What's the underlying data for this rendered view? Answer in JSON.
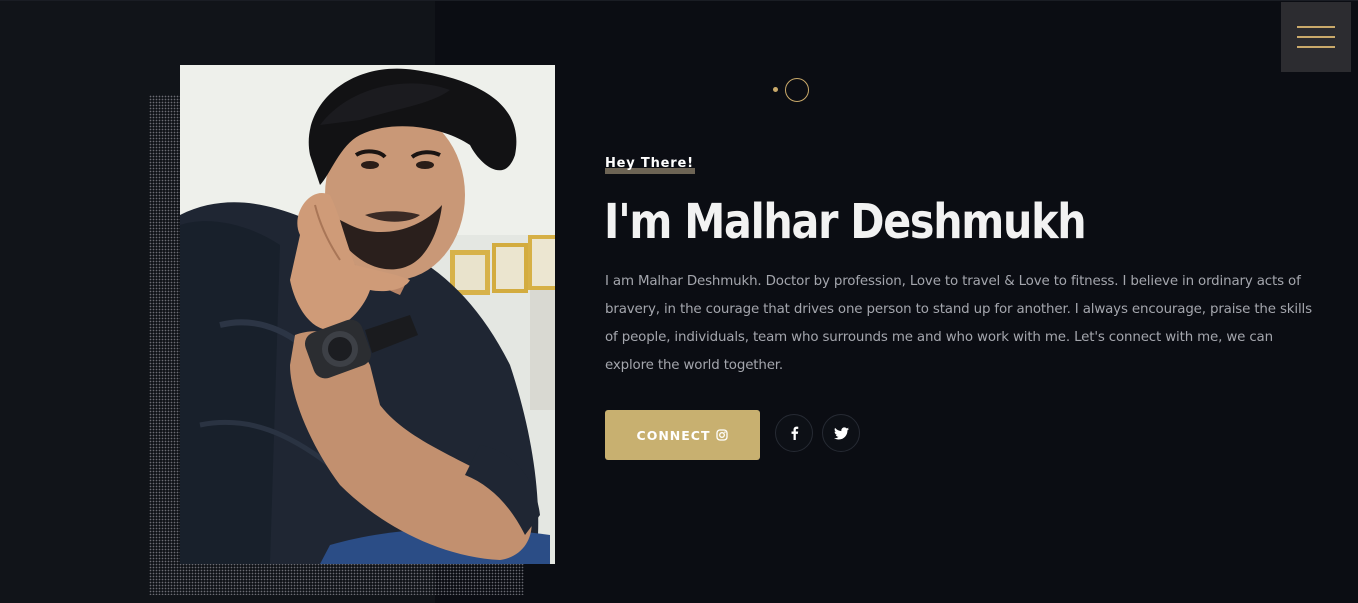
{
  "header": {
    "menu_icon": "hamburger-menu-icon"
  },
  "hero": {
    "greeting": "Hey There!",
    "headline": "I'm Malhar Deshmukh",
    "bio": "I am Malhar Deshmukh. Doctor by profession, Love to travel & Love to fitness. I believe in ordinary acts of bravery, in the courage that drives one person to stand up for another. I always encourage, praise the skills of people, individuals, team who surrounds me and who work with me. Let's connect with me, we can explore the world together.",
    "connect_label": "CONNECT",
    "connect_icon": "instagram-icon",
    "social": [
      {
        "icon": "facebook-icon"
      },
      {
        "icon": "twitter-icon"
      }
    ]
  },
  "colors": {
    "accent": "#c8b070",
    "background": "#0b0d13",
    "menu_background": "#2c2c30",
    "text": "#f2f2f2",
    "muted_text": "#a4a6ad"
  }
}
